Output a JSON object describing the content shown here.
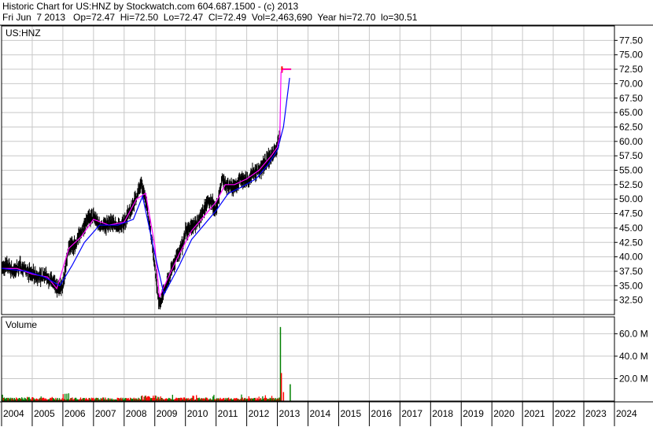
{
  "header": {
    "line1": "Historic Chart for US:HNZ by Stockwatch.com 604.687.1500 - (c) 2013",
    "line2": "Fri Jun  7 2013   Op=72.47  Hi=72.50  Lo=72.47  Cl=72.49  Vol=2,463,690  Year hi=72.70  lo=30.51"
  },
  "colors": {
    "price": "#000000",
    "ma_short": "#ff00ff",
    "ma_long": "#0000ff",
    "vol_up": "#008000",
    "vol_down": "#ff0000",
    "last_marker": "#ff0000",
    "grid": "#c8c8c8"
  },
  "chart_data": [
    {
      "type": "line",
      "label": "US:HNZ",
      "y_ticks": [
        "77.50",
        "75.00",
        "72.50",
        "70.00",
        "67.50",
        "65.00",
        "62.50",
        "60.00",
        "57.50",
        "55.00",
        "52.50",
        "50.00",
        "47.50",
        "45.00",
        "42.50",
        "40.00",
        "37.50",
        "35.00",
        "32.50"
      ],
      "ylim": [
        30,
        80
      ],
      "x_ticks": [
        "2004",
        "2005",
        "2006",
        "2007",
        "2008",
        "2009",
        "2010",
        "2011",
        "2012",
        "2013",
        "2014",
        "2015",
        "2016",
        "2017",
        "2018",
        "2019",
        "2020",
        "2021",
        "2022",
        "2023",
        "2024"
      ],
      "xlim": [
        2004.0,
        2024.0
      ],
      "grid": true,
      "series": [
        {
          "x": [
            2004.0,
            2004.2,
            2004.4,
            2004.6,
            2004.8,
            2005.0,
            2005.2,
            2005.4,
            2005.6,
            2005.8,
            2006.0,
            2006.2,
            2006.4,
            2006.6,
            2006.8,
            2007.0,
            2007.2,
            2007.4,
            2007.6,
            2007.8,
            2008.0,
            2008.2,
            2008.4,
            2008.55,
            2008.7,
            2008.9,
            2009.05,
            2009.15,
            2009.3,
            2009.5,
            2009.7,
            2009.9,
            2010.0,
            2010.2,
            2010.4,
            2010.6,
            2010.8,
            2011.0,
            2011.2,
            2011.4,
            2011.6,
            2011.8,
            2012.0,
            2012.2,
            2012.4,
            2012.6,
            2012.8,
            2013.0,
            2013.1,
            2013.15,
            2013.25,
            2013.45
          ],
          "values": [
            38.0,
            38.5,
            37.5,
            38.5,
            37.5,
            37.0,
            36.5,
            36.8,
            36.0,
            34.5,
            35.0,
            42.0,
            42.0,
            44.5,
            46.5,
            47.0,
            45.5,
            45.5,
            46.0,
            45.0,
            46.0,
            48.0,
            50.5,
            52.5,
            50.0,
            43.0,
            36.0,
            31.5,
            34.0,
            37.0,
            40.0,
            42.0,
            44.5,
            45.0,
            46.0,
            48.0,
            50.0,
            48.0,
            53.5,
            52.0,
            52.0,
            53.5,
            53.0,
            54.5,
            55.0,
            56.0,
            57.5,
            59.0,
            61.5,
            72.0,
            72.4,
            72.5
          ]
        },
        {
          "x": [
            2004.0,
            2004.5,
            2005.0,
            2005.5,
            2005.8,
            2006.2,
            2006.6,
            2007.0,
            2007.5,
            2008.0,
            2008.4,
            2008.7,
            2009.0,
            2009.15,
            2009.4,
            2009.8,
            2010.2,
            2010.6,
            2011.0,
            2011.3,
            2011.6,
            2012.0,
            2012.4,
            2012.8,
            2013.0,
            2013.08,
            2013.12,
            2013.2,
            2013.45
          ],
          "values": [
            38.0,
            38.0,
            37.0,
            36.5,
            34.5,
            41.5,
            43.5,
            46.5,
            45.5,
            46.0,
            50.0,
            51.0,
            42.0,
            33.0,
            36.0,
            40.5,
            44.5,
            47.0,
            49.5,
            52.5,
            52.5,
            53.5,
            55.0,
            57.5,
            59.0,
            61.0,
            72.0,
            72.5,
            72.5
          ]
        },
        {
          "x": [
            2004.0,
            2004.8,
            2005.4,
            2005.9,
            2006.3,
            2006.7,
            2007.2,
            2007.8,
            2008.3,
            2008.6,
            2009.0,
            2009.3,
            2009.8,
            2010.2,
            2010.6,
            2011.0,
            2011.4,
            2011.8,
            2012.3,
            2012.7,
            2013.0,
            2013.2,
            2013.4
          ],
          "values": [
            38.0,
            37.5,
            36.5,
            35.0,
            38.5,
            42.5,
            45.5,
            45.5,
            46.5,
            50.5,
            40.5,
            33.5,
            38.5,
            43.0,
            45.5,
            48.0,
            51.0,
            52.0,
            53.5,
            56.0,
            58.5,
            62.5,
            71.0
          ]
        }
      ]
    },
    {
      "type": "bar",
      "label": "Volume",
      "y_ticks": [
        "60.0 M",
        "40.0 M",
        "20.0 M"
      ],
      "ylim": [
        0,
        75
      ],
      "spikes": [
        {
          "x": 2013.1,
          "value": 66.0,
          "dir": "up"
        },
        {
          "x": 2013.13,
          "value": 25.0,
          "dir": "down"
        },
        {
          "x": 2013.2,
          "value": 8.0,
          "dir": "down"
        },
        {
          "x": 2013.42,
          "value": 15.0,
          "dir": "up"
        }
      ]
    }
  ]
}
